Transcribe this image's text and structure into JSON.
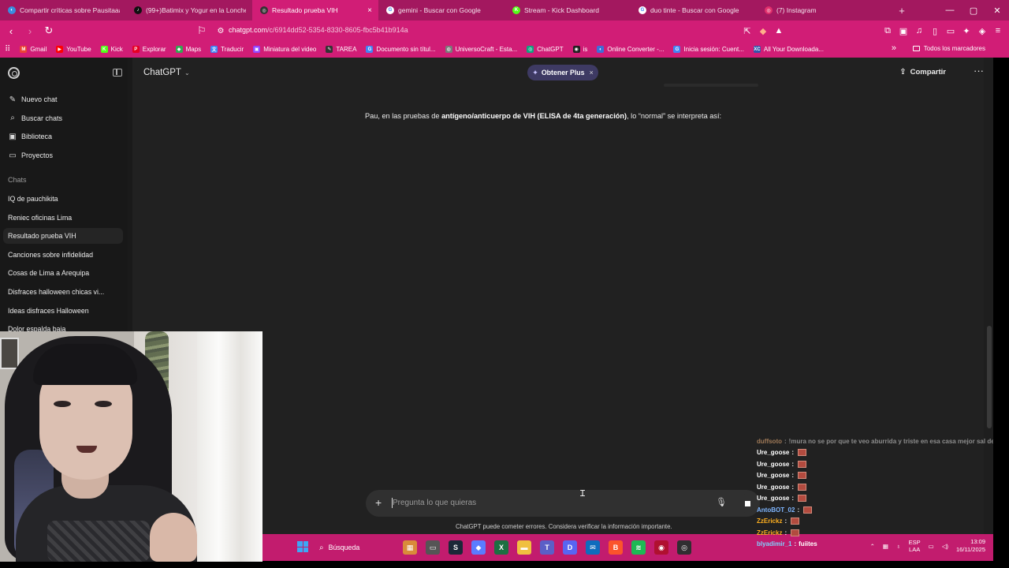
{
  "browser": {
    "tabs": [
      {
        "title": "Compartir críticas sobre Pausitaaa d",
        "color": "#3a8dde",
        "glyph": "◐"
      },
      {
        "title": "(99+)Batimix y Yogur en la Lonchera",
        "color": "#111111",
        "glyph": "♪"
      },
      {
        "title": "Resultado prueba VIH",
        "color": "#333333",
        "glyph": "◎",
        "active": true
      },
      {
        "title": "gemini - Buscar con Google",
        "color": "#ffffff",
        "glyph": "G"
      },
      {
        "title": "Stream - Kick Dashboard",
        "color": "#53fc18",
        "glyph": "K"
      },
      {
        "title": "duo tinte - Buscar con Google",
        "color": "#ffffff",
        "glyph": "G"
      },
      {
        "title": "(7) Instagram",
        "color": "#e1306c",
        "glyph": "◎"
      }
    ],
    "new_tab_label": "+",
    "url_host": "chatgpt.com",
    "url_path": "/c/6914dd52-5354-8330-8605-fbc5b41b914a",
    "bookmarks": [
      {
        "label": "Gmail",
        "color": "#ea4335",
        "glyph": "M"
      },
      {
        "label": "YouTube",
        "color": "#ff0000",
        "glyph": "▶"
      },
      {
        "label": "Kick",
        "color": "#53fc18",
        "glyph": "K"
      },
      {
        "label": "Explorar",
        "color": "#e60023",
        "glyph": "P"
      },
      {
        "label": "Maps",
        "color": "#34a853",
        "glyph": "◆"
      },
      {
        "label": "Traducir",
        "color": "#4285f4",
        "glyph": "文"
      },
      {
        "label": "Miniatura del video",
        "color": "#9146ff",
        "glyph": "▣"
      },
      {
        "label": "TAREA",
        "color": "#333333",
        "glyph": "✎"
      },
      {
        "label": "Documento sin títul...",
        "color": "#4285f4",
        "glyph": "G"
      },
      {
        "label": "UniversoCraft - Esta...",
        "color": "#7a7a7a",
        "glyph": "◍"
      },
      {
        "label": "ChatGPT",
        "color": "#10a37f",
        "glyph": "◎"
      },
      {
        "label": "is",
        "color": "#222222",
        "glyph": "◉"
      },
      {
        "label": "Online Converter -...",
        "color": "#3d6fd8",
        "glyph": "◐"
      },
      {
        "label": "Inicia sesión: Cuent...",
        "color": "#4285f4",
        "glyph": "G"
      },
      {
        "label": "All Your Downloada...",
        "color": "#3355aa",
        "glyph": "XC"
      }
    ],
    "all_bookmarks_label": "Todos los marcadores"
  },
  "sidebar": {
    "actions": [
      {
        "label": "Nuevo chat",
        "icon": "new-chat-icon",
        "glyph": "✎"
      },
      {
        "label": "Buscar chats",
        "icon": "search-icon",
        "glyph": "⌕"
      },
      {
        "label": "Biblioteca",
        "icon": "library-icon",
        "glyph": "▣"
      },
      {
        "label": "Proyectos",
        "icon": "folder-icon",
        "glyph": "▭"
      }
    ],
    "section_label": "Chats",
    "chats": [
      "IQ de pauchikita",
      "Reniec oficinas Lima",
      "Resultado prueba VIH",
      "Canciones sobre infidelidad",
      "Cosas de Lima a Arequipa",
      "Disfraces halloween chicas vi...",
      "Ideas disfraces Halloween",
      "Dolor espalda baja"
    ],
    "active_chat_index": 2
  },
  "header": {
    "model": "ChatGPT",
    "upgrade_label": "Obtener Plus",
    "share_label": "Compartir"
  },
  "message": {
    "prefix": "Pau, en las pruebas de ",
    "bold": "antígeno/anticuerpo de VIH (ELISA de 4ta generación)",
    "suffix": ", lo “normal” se interpreta así:"
  },
  "composer": {
    "placeholder": "Pregunta lo que quieras",
    "disclaimer": "ChatGPT puede cometer errores. Considera verificar la información importante."
  },
  "stream_chat": [
    {
      "user": "duffsoto",
      "text": "!mura no se por que te veo aburrida y triste en esa casa mejor sal de ahi",
      "color": "#a07a58",
      "faded": true,
      "emote": false
    },
    {
      "user": "Ure_goose",
      "text": "",
      "color": "#ffffff",
      "emote": true
    },
    {
      "user": "Ure_goose",
      "text": "",
      "color": "#ffffff",
      "emote": true
    },
    {
      "user": "Ure_goose",
      "text": "",
      "color": "#ffffff",
      "emote": true
    },
    {
      "user": "Ure_goose",
      "text": "",
      "color": "#ffffff",
      "emote": true
    },
    {
      "user": "Ure_goose",
      "text": "",
      "color": "#ffffff",
      "emote": true
    },
    {
      "user": "AntoBOT_02",
      "text": "",
      "color": "#7fb6ff",
      "emote": true
    },
    {
      "user": "ZzErickz",
      "text": "",
      "color": "#ffb020",
      "emote": true
    },
    {
      "user": "ZzErickz",
      "text": "",
      "color": "#ffb020",
      "emote": true
    },
    {
      "user": "blyadimir_1",
      "text": "fuiites",
      "color": "#7fd3ff",
      "emote": false
    }
  ],
  "taskbar": {
    "search_label": "Búsqueda",
    "apps": [
      {
        "name": "widget-icon",
        "color": "#d98b3a",
        "glyph": "▦"
      },
      {
        "name": "task-view-icon",
        "color": "#555555",
        "glyph": "▭"
      },
      {
        "name": "steam-icon",
        "color": "#1b2838",
        "glyph": "S"
      },
      {
        "name": "copilot-icon",
        "color": "#5a7cff",
        "glyph": "◆"
      },
      {
        "name": "excel-icon",
        "color": "#1d6f42",
        "glyph": "X"
      },
      {
        "name": "explorer-icon",
        "color": "#f0c040",
        "glyph": "▬"
      },
      {
        "name": "teams-icon",
        "color": "#5b5fc7",
        "glyph": "T"
      },
      {
        "name": "discord-icon",
        "color": "#5865f2",
        "glyph": "D"
      },
      {
        "name": "mail-icon",
        "color": "#0f6cbd",
        "glyph": "✉"
      },
      {
        "name": "brave-icon",
        "color": "#fb542b",
        "glyph": "B"
      },
      {
        "name": "spotify-icon",
        "color": "#1db954",
        "glyph": "≋"
      },
      {
        "name": "app-icon",
        "color": "#b01030",
        "glyph": "◉"
      },
      {
        "name": "obs-icon",
        "color": "#302e31",
        "glyph": "◎"
      }
    ],
    "lang_top": "ESP",
    "lang_bottom": "LAA",
    "time": "13:09",
    "date": "16/11/2025"
  }
}
